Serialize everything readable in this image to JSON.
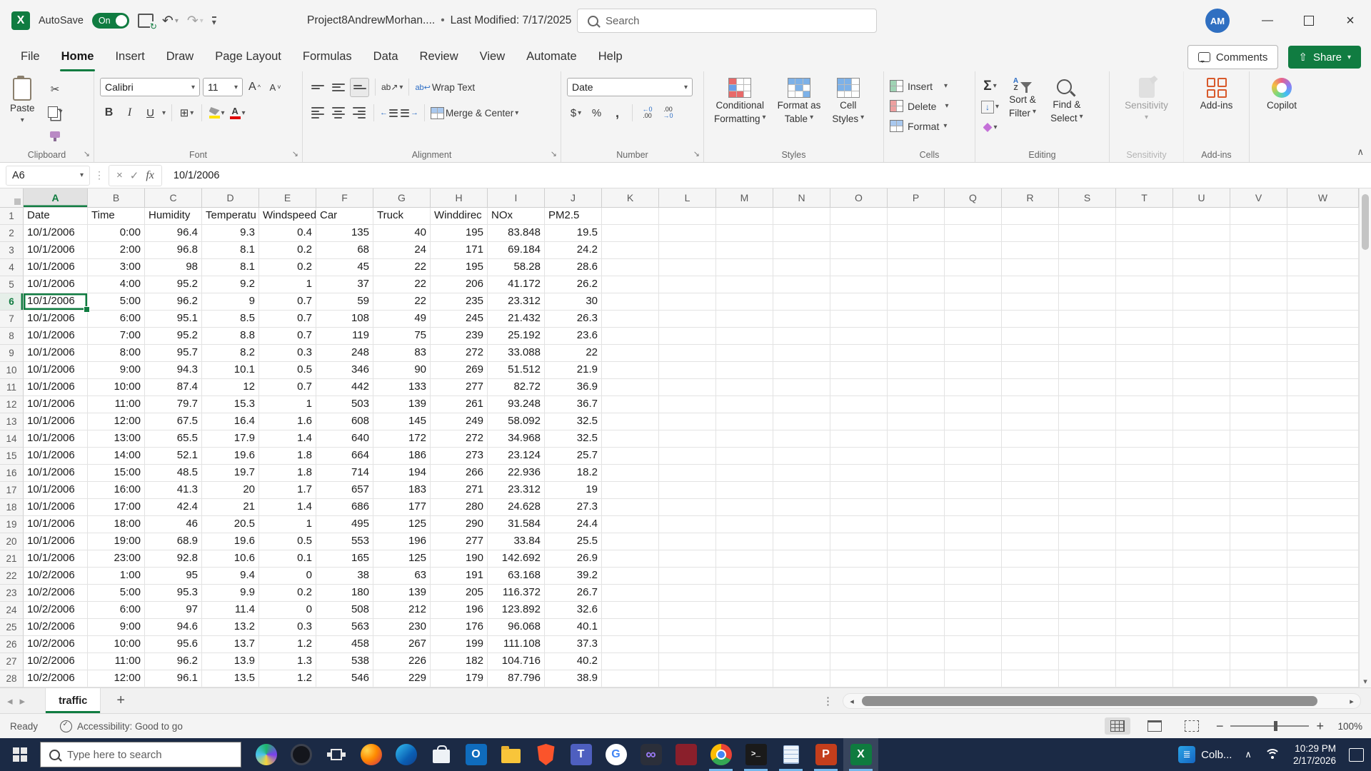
{
  "titlebar": {
    "app": "Excel",
    "autosave_label": "AutoSave",
    "autosave_state": "On",
    "doc_title": "Project8AndrewMorhan....",
    "title_separator": "•",
    "last_modified": "Last Modified: 7/17/2025",
    "search_placeholder": "Search",
    "avatar_initials": "AM",
    "minimize_glyph": "—",
    "close_glyph": "×"
  },
  "menu": {
    "tabs": [
      "File",
      "Home",
      "Insert",
      "Draw",
      "Page Layout",
      "Formulas",
      "Data",
      "Review",
      "View",
      "Automate",
      "Help"
    ],
    "active_tab": "Home",
    "comments_label": "Comments",
    "share_label": "Share"
  },
  "ribbon": {
    "paste_label": "Paste",
    "font_name": "Calibri",
    "font_size": "11",
    "wrap_text_label": "Wrap Text",
    "merge_center_label": "Merge & Center",
    "number_format": "Date",
    "dollar": "$",
    "percent": "%",
    "comma": ",",
    "inc_dec_top": "←0",
    "inc_dec_bot": ".00",
    "dec_dec_top": ".00",
    "dec_dec_bot": "→0",
    "cond_fmt_l1": "Conditional",
    "cond_fmt_l2": "Formatting",
    "format_table_l1": "Format as",
    "format_table_l2": "Table",
    "cell_styles_l1": "Cell",
    "cell_styles_l2": "Styles",
    "insert_label": "Insert",
    "delete_label": "Delete",
    "format_label": "Format",
    "sigma": "Σ",
    "sort_filter_l1": "Sort &",
    "sort_filter_l2": "Filter",
    "find_select_l1": "Find &",
    "find_select_l2": "Select",
    "az_a": "A",
    "az_z": "Z",
    "sensitivity_label": "Sensitivity",
    "addins_label": "Add-ins",
    "copilot_label": "Copilot",
    "group_labels": {
      "clipboard": "Clipboard",
      "font": "Font",
      "alignment": "Alignment",
      "number": "Number",
      "styles": "Styles",
      "cells": "Cells",
      "editing": "Editing",
      "sensitivity": "Sensitivity",
      "addins": "Add-ins"
    }
  },
  "formula_bar": {
    "name_box": "A6",
    "fx_label": "fx",
    "cancel_glyph": "×",
    "enter_glyph": "✓",
    "formula": "10/1/2006"
  },
  "grid": {
    "column_letters": [
      "A",
      "B",
      "C",
      "D",
      "E",
      "F",
      "G",
      "H",
      "I",
      "J",
      "K",
      "L",
      "M",
      "N",
      "O",
      "P",
      "Q",
      "R",
      "S",
      "T",
      "U",
      "V",
      "W"
    ],
    "row_count": 28,
    "selected": {
      "ref": "A6",
      "row": 6,
      "col_index": 0
    },
    "data_headers": [
      "Date",
      "Time",
      "Humidity",
      "Temperatu",
      "Windspeed",
      "Car",
      "Truck",
      "Winddirec",
      "NOx",
      "PM2.5"
    ],
    "rows": [
      [
        "10/1/2006",
        "0:00",
        "96.4",
        "9.3",
        "0.4",
        "135",
        "40",
        "195",
        "83.848",
        "19.5"
      ],
      [
        "10/1/2006",
        "2:00",
        "96.8",
        "8.1",
        "0.2",
        "68",
        "24",
        "171",
        "69.184",
        "24.2"
      ],
      [
        "10/1/2006",
        "3:00",
        "98",
        "8.1",
        "0.2",
        "45",
        "22",
        "195",
        "58.28",
        "28.6"
      ],
      [
        "10/1/2006",
        "4:00",
        "95.2",
        "9.2",
        "1",
        "37",
        "22",
        "206",
        "41.172",
        "26.2"
      ],
      [
        "10/1/2006",
        "5:00",
        "96.2",
        "9",
        "0.7",
        "59",
        "22",
        "235",
        "23.312",
        "30"
      ],
      [
        "10/1/2006",
        "6:00",
        "95.1",
        "8.5",
        "0.7",
        "108",
        "49",
        "245",
        "21.432",
        "26.3"
      ],
      [
        "10/1/2006",
        "7:00",
        "95.2",
        "8.8",
        "0.7",
        "119",
        "75",
        "239",
        "25.192",
        "23.6"
      ],
      [
        "10/1/2006",
        "8:00",
        "95.7",
        "8.2",
        "0.3",
        "248",
        "83",
        "272",
        "33.088",
        "22"
      ],
      [
        "10/1/2006",
        "9:00",
        "94.3",
        "10.1",
        "0.5",
        "346",
        "90",
        "269",
        "51.512",
        "21.9"
      ],
      [
        "10/1/2006",
        "10:00",
        "87.4",
        "12",
        "0.7",
        "442",
        "133",
        "277",
        "82.72",
        "36.9"
      ],
      [
        "10/1/2006",
        "11:00",
        "79.7",
        "15.3",
        "1",
        "503",
        "139",
        "261",
        "93.248",
        "36.7"
      ],
      [
        "10/1/2006",
        "12:00",
        "67.5",
        "16.4",
        "1.6",
        "608",
        "145",
        "249",
        "58.092",
        "32.5"
      ],
      [
        "10/1/2006",
        "13:00",
        "65.5",
        "17.9",
        "1.4",
        "640",
        "172",
        "272",
        "34.968",
        "32.5"
      ],
      [
        "10/1/2006",
        "14:00",
        "52.1",
        "19.6",
        "1.8",
        "664",
        "186",
        "273",
        "23.124",
        "25.7"
      ],
      [
        "10/1/2006",
        "15:00",
        "48.5",
        "19.7",
        "1.8",
        "714",
        "194",
        "266",
        "22.936",
        "18.2"
      ],
      [
        "10/1/2006",
        "16:00",
        "41.3",
        "20",
        "1.7",
        "657",
        "183",
        "271",
        "23.312",
        "19"
      ],
      [
        "10/1/2006",
        "17:00",
        "42.4",
        "21",
        "1.4",
        "686",
        "177",
        "280",
        "24.628",
        "27.3"
      ],
      [
        "10/1/2006",
        "18:00",
        "46",
        "20.5",
        "1",
        "495",
        "125",
        "290",
        "31.584",
        "24.4"
      ],
      [
        "10/1/2006",
        "19:00",
        "68.9",
        "19.6",
        "0.5",
        "553",
        "196",
        "277",
        "33.84",
        "25.5"
      ],
      [
        "10/1/2006",
        "23:00",
        "92.8",
        "10.6",
        "0.1",
        "165",
        "125",
        "190",
        "142.692",
        "26.9"
      ],
      [
        "10/2/2006",
        "1:00",
        "95",
        "9.4",
        "0",
        "38",
        "63",
        "191",
        "63.168",
        "39.2"
      ],
      [
        "10/2/2006",
        "5:00",
        "95.3",
        "9.9",
        "0.2",
        "180",
        "139",
        "205",
        "116.372",
        "26.7"
      ],
      [
        "10/2/2006",
        "6:00",
        "97",
        "11.4",
        "0",
        "508",
        "212",
        "196",
        "123.892",
        "32.6"
      ],
      [
        "10/2/2006",
        "9:00",
        "94.6",
        "13.2",
        "0.3",
        "563",
        "230",
        "176",
        "96.068",
        "40.1"
      ],
      [
        "10/2/2006",
        "10:00",
        "95.6",
        "13.7",
        "1.2",
        "458",
        "267",
        "199",
        "111.108",
        "37.3"
      ],
      [
        "10/2/2006",
        "11:00",
        "96.2",
        "13.9",
        "1.3",
        "538",
        "226",
        "182",
        "104.716",
        "40.2"
      ],
      [
        "10/2/2006",
        "12:00",
        "96.1",
        "13.5",
        "1.2",
        "546",
        "229",
        "179",
        "87.796",
        "38.9"
      ]
    ]
  },
  "sheet_tabs": {
    "active_tab": "traffic",
    "add_label": "+"
  },
  "status_bar": {
    "ready_label": "Ready",
    "accessibility_label": "Accessibility: Good to go",
    "zoom_level": "100%"
  },
  "taskbar": {
    "search_placeholder": "Type here to search",
    "icons": [
      {
        "name": "swirl-app-icon",
        "glyph": ""
      },
      {
        "name": "dark-circle-app-icon",
        "glyph": ""
      },
      {
        "name": "task-view-icon",
        "glyph": ""
      },
      {
        "name": "firefox-icon",
        "glyph": ""
      },
      {
        "name": "edge-icon",
        "glyph": ""
      },
      {
        "name": "store-icon",
        "glyph": ""
      },
      {
        "name": "outlook-icon",
        "glyph": "O"
      },
      {
        "name": "file-explorer-icon",
        "glyph": ""
      },
      {
        "name": "brave-icon",
        "glyph": ""
      },
      {
        "name": "teams-icon",
        "glyph": "T"
      },
      {
        "name": "google-icon",
        "glyph": "G"
      },
      {
        "name": "infinity-app-icon",
        "glyph": "∞"
      },
      {
        "name": "dark-red-app-icon",
        "glyph": ""
      },
      {
        "name": "chrome-icon",
        "glyph": "",
        "running": true
      },
      {
        "name": "terminal-icon",
        "glyph": ">_",
        "running": true
      },
      {
        "name": "notepad-icon",
        "glyph": "",
        "running": true
      },
      {
        "name": "powerpoint-icon",
        "glyph": "P",
        "running": true
      },
      {
        "name": "excel-taskbar-icon",
        "glyph": "X",
        "running": true,
        "active": true
      }
    ],
    "tray_app_label": "Colb...",
    "clock_time": "10:29 PM",
    "clock_date": "2/17/2026"
  }
}
